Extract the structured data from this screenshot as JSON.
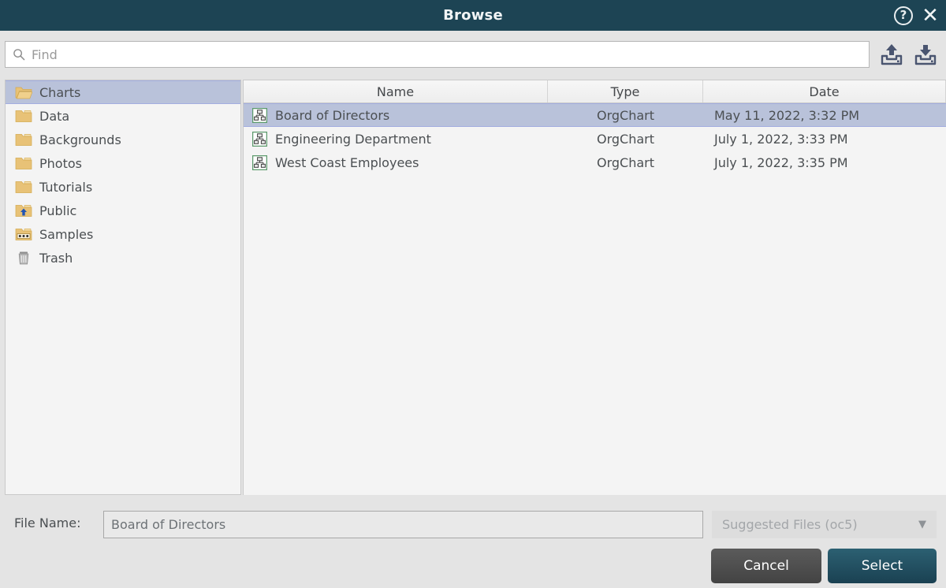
{
  "window": {
    "title": "Browse",
    "help_icon": "help-circle-icon",
    "close_icon": "close-icon"
  },
  "search": {
    "placeholder": "Find",
    "value": "",
    "icon": "search-icon",
    "upload_icon": "upload-icon",
    "download_icon": "download-icon"
  },
  "sidebar": {
    "items": [
      {
        "label": "Charts",
        "icon": "folder-open-icon",
        "selected": true
      },
      {
        "label": "Data",
        "icon": "folder-icon",
        "selected": false
      },
      {
        "label": "Backgrounds",
        "icon": "folder-icon",
        "selected": false
      },
      {
        "label": "Photos",
        "icon": "folder-icon",
        "selected": false
      },
      {
        "label": "Tutorials",
        "icon": "folder-icon",
        "selected": false
      },
      {
        "label": "Public",
        "icon": "folder-public-icon",
        "selected": false
      },
      {
        "label": "Samples",
        "icon": "folder-samples-icon",
        "selected": false
      },
      {
        "label": "Trash",
        "icon": "trash-icon",
        "selected": false
      }
    ]
  },
  "filelist": {
    "columns": [
      "Name",
      "Type",
      "Date"
    ],
    "rows": [
      {
        "name": "Board of Directors",
        "type": "OrgChart",
        "date": "May 11, 2022, 3:32 PM",
        "icon": "orgchart-icon",
        "selected": true
      },
      {
        "name": "Engineering Department",
        "type": "OrgChart",
        "date": "July 1, 2022, 3:33 PM",
        "icon": "orgchart-icon",
        "selected": false
      },
      {
        "name": "West Coast Employees",
        "type": "OrgChart",
        "date": "July 1, 2022, 3:35 PM",
        "icon": "orgchart-icon",
        "selected": false
      }
    ]
  },
  "footer": {
    "file_name_label": "File Name:",
    "file_name_value": "Board of Directors",
    "file_type_selected": "Suggested Files (oc5)",
    "file_type_options": [
      "Suggested Files (oc5)"
    ],
    "cancel_label": "Cancel",
    "select_label": "Select"
  },
  "colors": {
    "titlebar": "#1d4454",
    "accent": "#1a4152",
    "selection": "#b9c2da",
    "folder": "#e8c277"
  }
}
